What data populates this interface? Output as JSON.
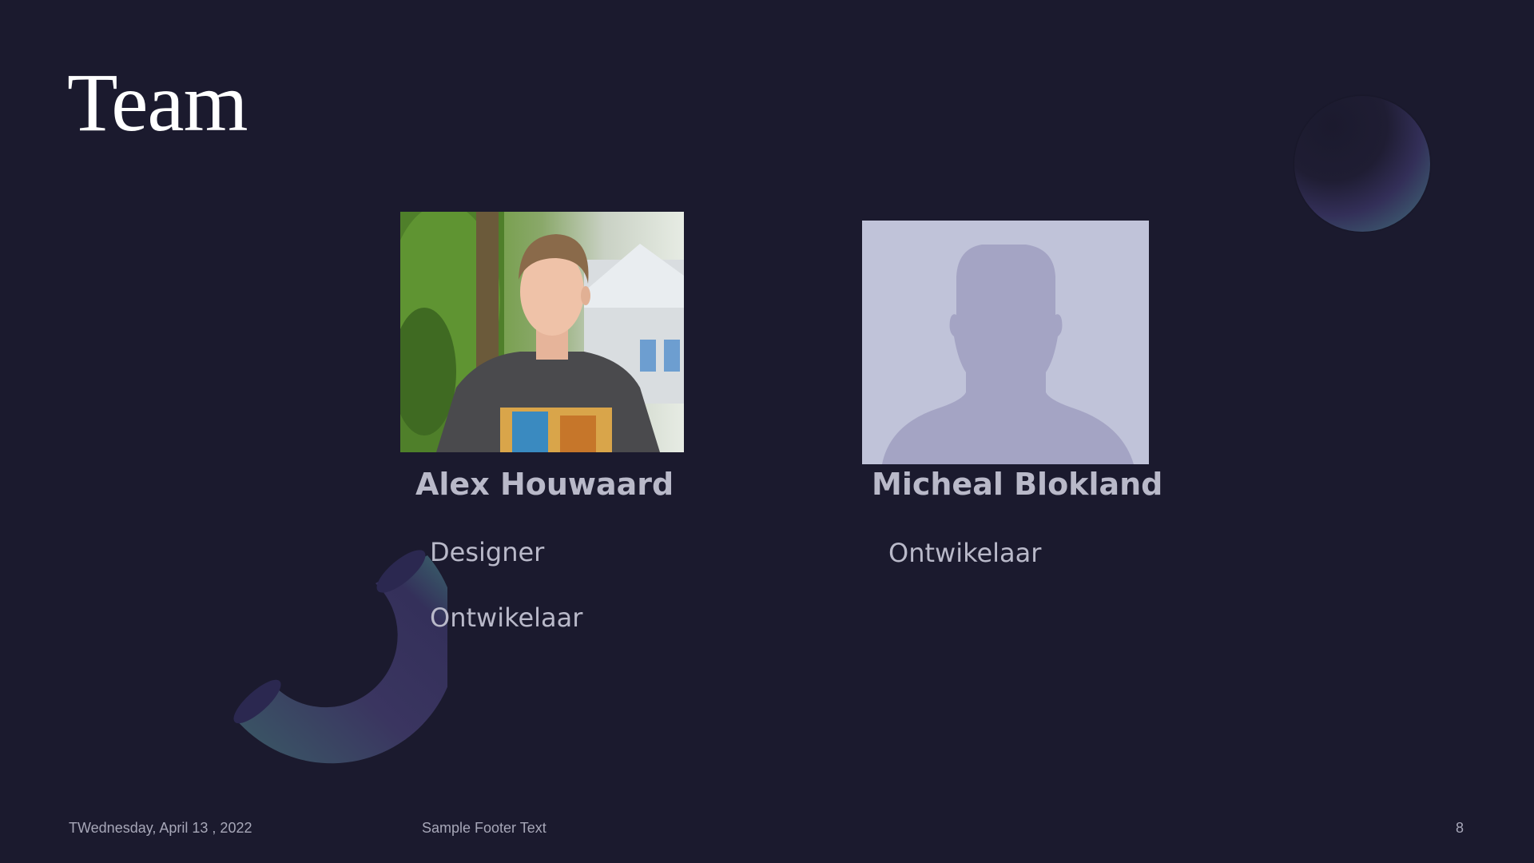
{
  "slide": {
    "title": "Team",
    "members": [
      {
        "name": "Alex Houwaard",
        "roles": [
          "Designer",
          "Ontwikelaar"
        ]
      },
      {
        "name": "Micheal Blokland",
        "roles": [
          "Ontwikelaar"
        ]
      }
    ],
    "footer": {
      "date": "TWednesday, April 13 , 2022",
      "text": "Sample Footer Text",
      "page_number": "8"
    }
  },
  "colors": {
    "background": "#1b1a2e",
    "title_text": "#ffffff",
    "body_text": "#b9b9c9",
    "placeholder_bg": "#c0c3d9",
    "placeholder_silhouette": "#a4a4c4",
    "accent_teal": "#3d7a78",
    "accent_purple": "#332f58"
  },
  "icons": {
    "decor_sphere": "sphere-decoration",
    "decor_torus": "half-torus-decoration",
    "placeholder": "person-silhouette-icon"
  }
}
